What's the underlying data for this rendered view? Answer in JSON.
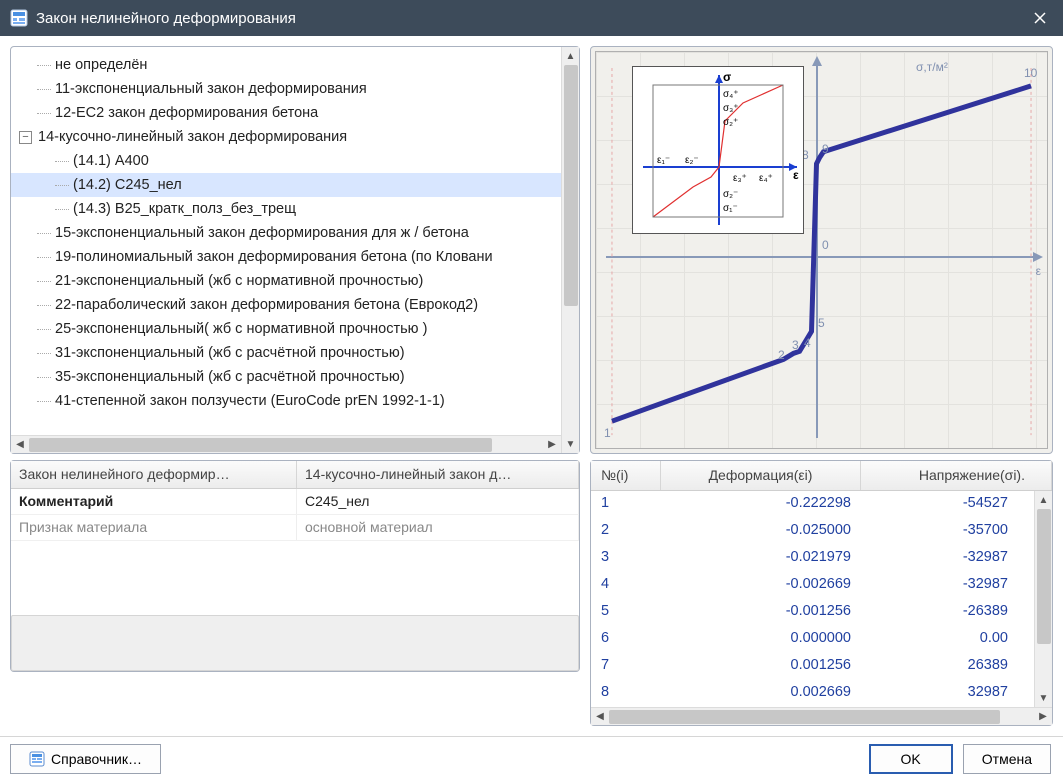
{
  "window": {
    "title": "Закон нелинейного деформирования"
  },
  "tree": [
    {
      "lvl": 0,
      "tw": "dash",
      "label": "не определён"
    },
    {
      "lvl": 0,
      "tw": "dash",
      "label": "11-экспоненциальный закон деформирования"
    },
    {
      "lvl": 0,
      "tw": "dash",
      "label": "12-EC2 закон деформирования бетона"
    },
    {
      "lvl": 0,
      "tw": "minus",
      "label": "14-кусочно-линейный закон деформирования"
    },
    {
      "lvl": 1,
      "tw": "dash",
      "label": "(14.1) А400"
    },
    {
      "lvl": 1,
      "tw": "dash",
      "label": "(14.2) С245_нел",
      "selected": true
    },
    {
      "lvl": 1,
      "tw": "dash",
      "label": "(14.3) В25_кратк_полз_без_трещ"
    },
    {
      "lvl": 0,
      "tw": "dash",
      "label": "15-экспоненциальный закон деформирования для ж / бетона"
    },
    {
      "lvl": 0,
      "tw": "dash",
      "label": "19-полиномиальный закон деформирования бетона (по Кловани"
    },
    {
      "lvl": 0,
      "tw": "dash",
      "label": "21-экспоненциальный (жб с нормативной прочностью)"
    },
    {
      "lvl": 0,
      "tw": "dash",
      "label": "22-параболический закон деформирования бетона (Еврокод2)"
    },
    {
      "lvl": 0,
      "tw": "dash",
      "label": "25-экспоненциальный( жб с нормативной прочностью )"
    },
    {
      "lvl": 0,
      "tw": "dash",
      "label": "31-экспоненциальный (жб с расчётной прочностью)"
    },
    {
      "lvl": 0,
      "tw": "dash",
      "label": "35-экспоненциальный (жб с расчётной прочностью)"
    },
    {
      "lvl": 0,
      "tw": "dash",
      "label": "41-степенной закон ползучести (EuroCode prEN 1992-1-1)"
    }
  ],
  "props": {
    "header0": "Закон нелинейного деформир…",
    "header1": "14-кусочно-линейный закон д…",
    "rows": [
      {
        "k": "Комментарий",
        "v": "С245_нел"
      },
      {
        "k": "Признак материала",
        "v": "основной материал"
      }
    ]
  },
  "graph": {
    "y_label": "σ,т/м²",
    "x_label": "ε",
    "zero_label": "0",
    "point_labels": [
      "1",
      "2",
      "3",
      "4",
      "5",
      "8",
      "9",
      "10"
    ]
  },
  "chart_data": {
    "type": "line",
    "title": "",
    "xlabel": "ε",
    "ylabel": "σ, т/м²",
    "series": [
      {
        "name": "С245_нел",
        "points": [
          {
            "i": 1,
            "eps": -0.222298,
            "sigma": -54527
          },
          {
            "i": 2,
            "eps": -0.025,
            "sigma": -35700
          },
          {
            "i": 3,
            "eps": -0.021979,
            "sigma": -32987
          },
          {
            "i": 4,
            "eps": -0.002669,
            "sigma": -32987
          },
          {
            "i": 5,
            "eps": -0.001256,
            "sigma": -26389
          },
          {
            "i": 6,
            "eps": 0.0,
            "sigma": 0.0
          },
          {
            "i": 7,
            "eps": 0.001256,
            "sigma": 26389
          },
          {
            "i": 8,
            "eps": 0.002669,
            "sigma": 32987
          }
        ]
      }
    ],
    "xlim": [
      -0.23,
      0.23
    ],
    "ylim": [
      -60000,
      60000
    ]
  },
  "dataTable": {
    "headers": [
      "№(i)",
      "Деформация(εi)",
      "Напряжение(σi)."
    ],
    "rows": [
      {
        "n": "1",
        "eps": "-0.222298",
        "sig": "-54527"
      },
      {
        "n": "2",
        "eps": "-0.025000",
        "sig": "-35700"
      },
      {
        "n": "3",
        "eps": "-0.021979",
        "sig": "-32987"
      },
      {
        "n": "4",
        "eps": "-0.002669",
        "sig": "-32987"
      },
      {
        "n": "5",
        "eps": "-0.001256",
        "sig": "-26389"
      },
      {
        "n": "6",
        "eps": "0.000000",
        "sig": "0.00"
      },
      {
        "n": "7",
        "eps": "0.001256",
        "sig": "26389"
      },
      {
        "n": "8",
        "eps": "0.002669",
        "sig": "32987"
      }
    ]
  },
  "buttons": {
    "reference": "Справочник…",
    "ok": "OK",
    "cancel": "Отмена"
  }
}
